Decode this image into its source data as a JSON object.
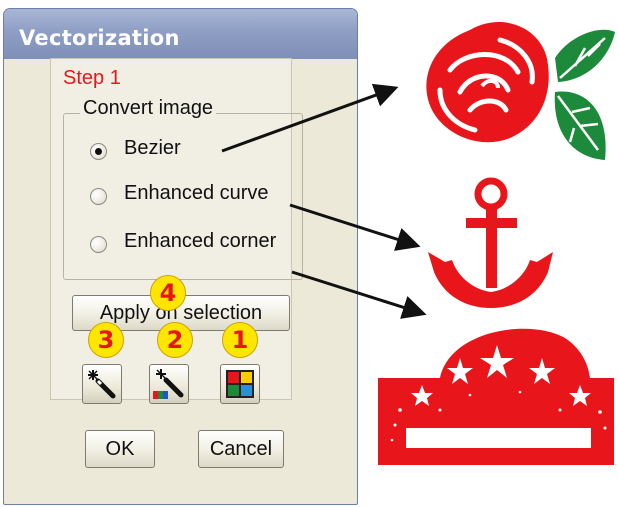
{
  "dialog": {
    "title": "Vectorization",
    "step_label": "Step 1",
    "group_label": "Convert image",
    "options": [
      {
        "label": "Bezier",
        "selected": true
      },
      {
        "label": "Enhanced curve",
        "selected": false
      },
      {
        "label": "Enhanced corner",
        "selected": false
      }
    ],
    "apply_button": "Apply on selection",
    "ok_button": "OK",
    "cancel_button": "Cancel",
    "tool_icons": [
      "magic-wand-icon",
      "color-magic-wand-icon",
      "color-grid-icon"
    ],
    "callouts": [
      "4",
      "3",
      "2",
      "1"
    ]
  },
  "examples": {
    "items": [
      "rose-with-leaves",
      "anchor",
      "star-banner"
    ],
    "colors": {
      "red": "#e8161b",
      "green": "#1c8a3a"
    }
  }
}
